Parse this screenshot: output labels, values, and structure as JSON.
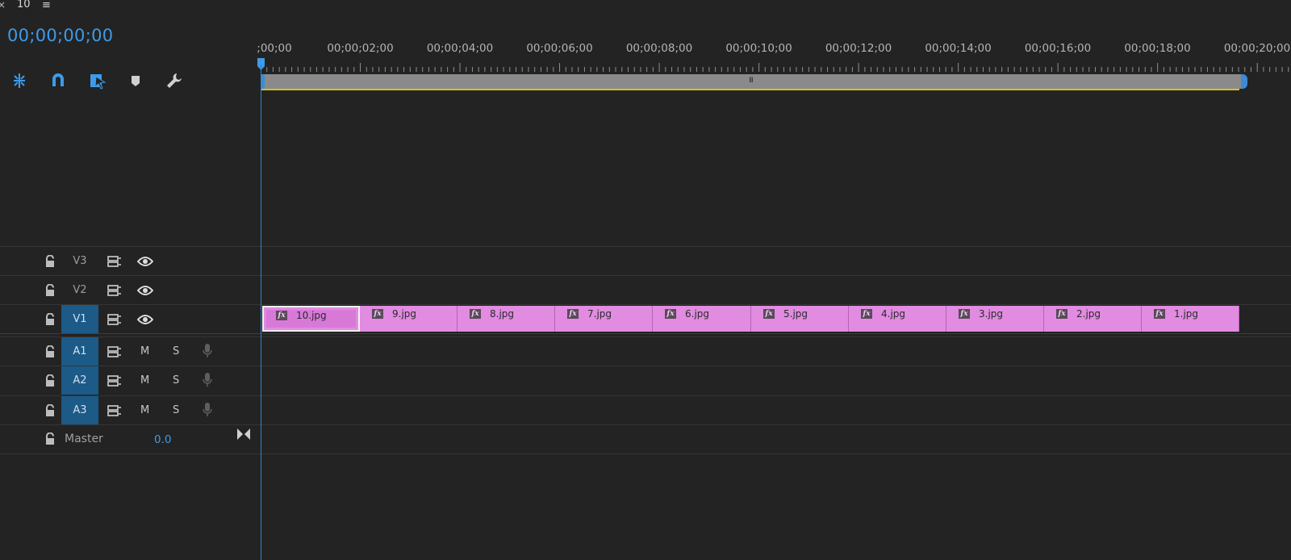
{
  "panel": {
    "close_symbol": "×",
    "title": "10",
    "menu_symbol": "≡"
  },
  "timecode": "00;00;00;00",
  "tools": [
    {
      "name": "insert-nest-icon"
    },
    {
      "name": "snap-magnet-icon"
    },
    {
      "name": "linked-selection-icon"
    },
    {
      "name": "add-marker-icon"
    },
    {
      "name": "wrench-icon"
    }
  ],
  "ruler": {
    "labels": [
      ";00;00",
      "00;00;02;00",
      "00;00;04;00",
      "00;00;06;00",
      "00;00;08;00",
      "00;00;10;00",
      "00;00;12;00",
      "00;00;14;00",
      "00;00;16;00",
      "00;00;18;00",
      "00;00;20;00"
    ]
  },
  "zoom_grip": "III",
  "video_tracks": [
    {
      "label": "V3",
      "active": false
    },
    {
      "label": "V2",
      "active": false
    },
    {
      "label": "V1",
      "active": true
    }
  ],
  "audio_tracks": [
    {
      "label": "A1",
      "mute": "M",
      "solo": "S"
    },
    {
      "label": "A2",
      "mute": "M",
      "solo": "S"
    },
    {
      "label": "A3",
      "mute": "M",
      "solo": "S"
    }
  ],
  "master": {
    "label": "Master",
    "value": "0.0"
  },
  "clips": [
    {
      "name": "10.jpg",
      "selected": true
    },
    {
      "name": "9.jpg"
    },
    {
      "name": "8.jpg"
    },
    {
      "name": "7.jpg"
    },
    {
      "name": "6.jpg"
    },
    {
      "name": "5.jpg"
    },
    {
      "name": "4.jpg"
    },
    {
      "name": "3.jpg"
    },
    {
      "name": "2.jpg"
    },
    {
      "name": "1.jpg"
    }
  ],
  "fx_badge": "fx",
  "colors": {
    "accent": "#3d9be9",
    "clip": "#e18be1",
    "track_active": "#1c5a87",
    "zoom_yellow": "#d6c21c"
  }
}
